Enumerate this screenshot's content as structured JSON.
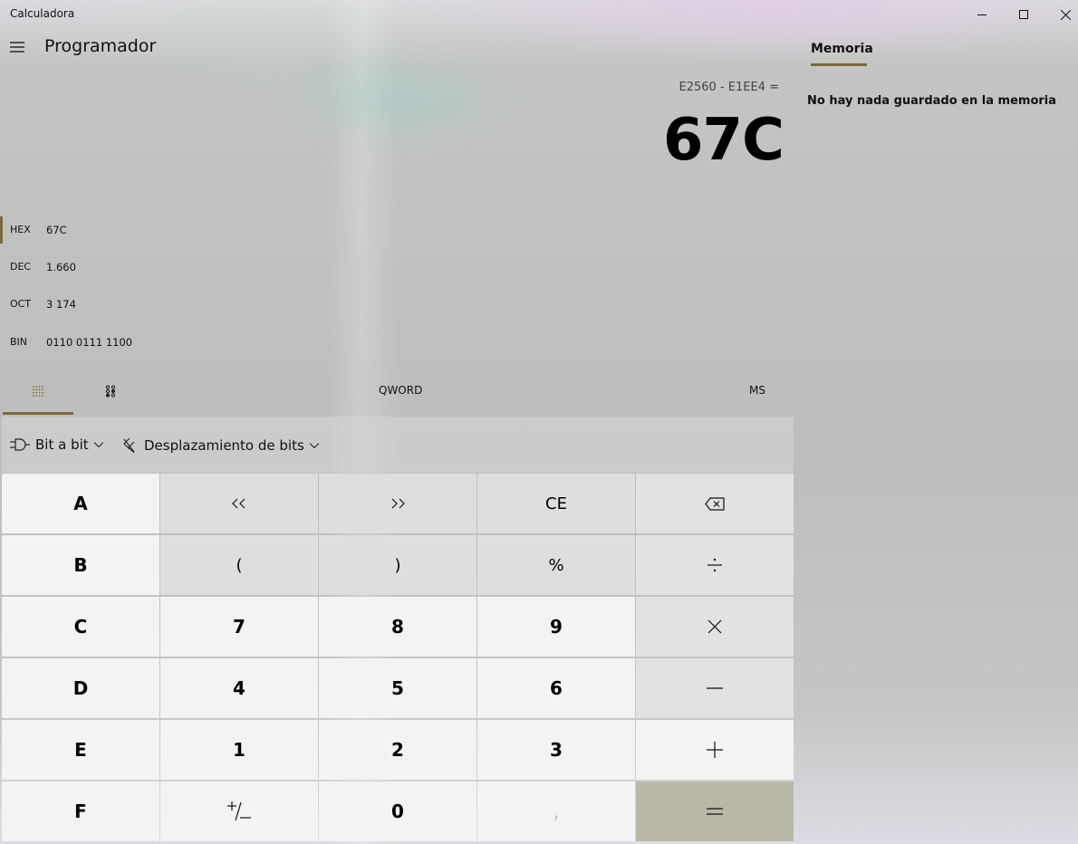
{
  "window": {
    "title": "Calculadora"
  },
  "header": {
    "mode": "Programador"
  },
  "memory": {
    "tab_label": "Memoria",
    "empty_message": "No hay nada guardado en la memoria"
  },
  "display": {
    "expression": "E2560 - E1EE4 =",
    "result": "67C"
  },
  "radix": [
    {
      "name": "HEX",
      "value": "67C",
      "selected": true
    },
    {
      "name": "DEC",
      "value": "1.660",
      "selected": false
    },
    {
      "name": "OCT",
      "value": "3 174",
      "selected": false
    },
    {
      "name": "BIN",
      "value": "0110 0111 1100",
      "selected": false
    }
  ],
  "tabs": {
    "word_size": "QWORD",
    "memory_store": "MS"
  },
  "bitbar": {
    "bitwise": "Bit a bit",
    "bitshift": "Desplazamiento de bits"
  },
  "keys": {
    "A": "A",
    "B": "B",
    "C": "C",
    "D": "D",
    "E": "E",
    "F": "F",
    "lshift": "<<",
    "rshift": ">>",
    "ce": "CE",
    "open_paren": "(",
    "close_paren": ")",
    "percent": "%",
    "seven": "7",
    "eight": "8",
    "nine": "9",
    "four": "4",
    "five": "5",
    "six": "6",
    "one": "1",
    "two": "2",
    "three": "3",
    "zero": "0",
    "decimal": ","
  },
  "colors": {
    "accent": "#7a6a3c",
    "equals_key": "#b9b8a8"
  }
}
